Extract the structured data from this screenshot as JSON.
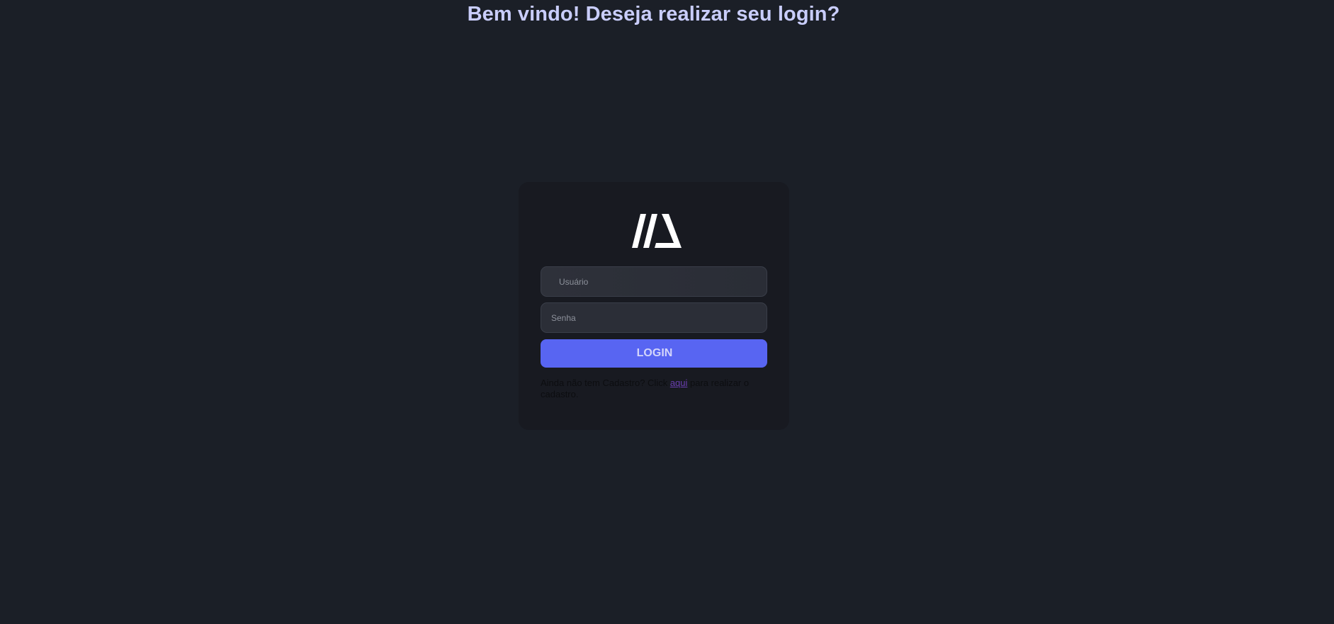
{
  "header": {
    "title": "Bem vindo! Deseja realizar seu login?"
  },
  "login_card": {
    "logo": {
      "icon": "brand-logo-icon",
      "color": "#ffffff"
    },
    "username": {
      "placeholder": "Usuário",
      "value": ""
    },
    "password": {
      "placeholder": "Senha",
      "value": ""
    },
    "login_button_label": "LOGIN",
    "signup": {
      "text_before": "Ainda não tem Cadastro? Click ",
      "link_label": "aqui",
      "text_after": " para realizar o cadastro."
    }
  },
  "colors": {
    "background": "#1b1f27",
    "card": "#181a21",
    "accent": "#5865f2",
    "title": "#c9cdfb",
    "link": "#6a3fb0"
  }
}
